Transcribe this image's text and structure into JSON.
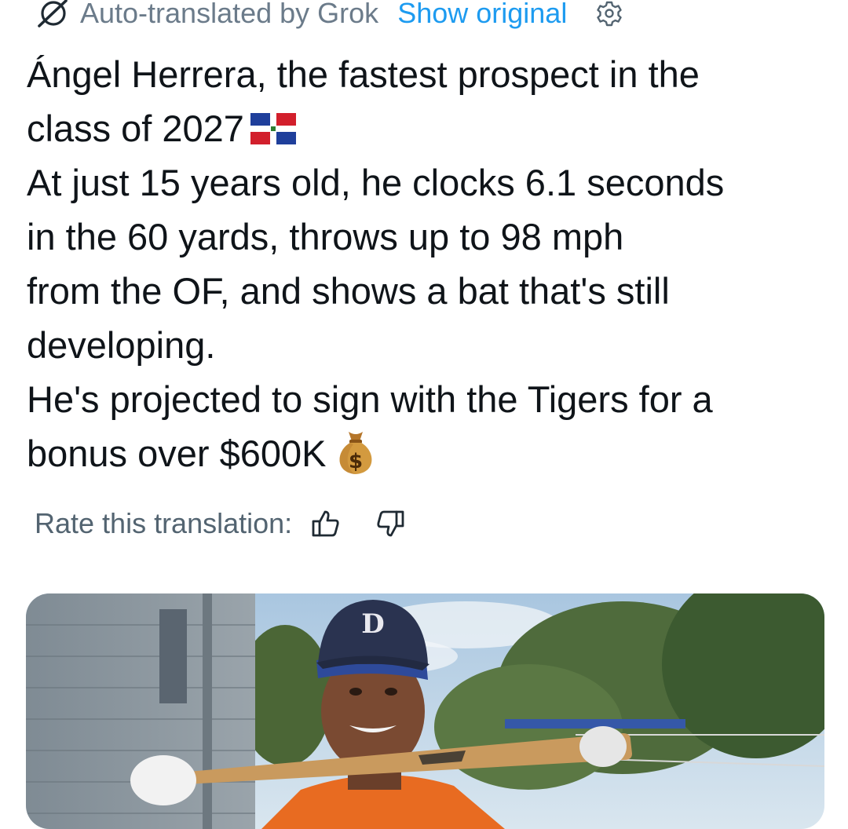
{
  "translation_bar": {
    "icon": "grok-icon",
    "label": "Auto-translated by Grok",
    "show_original": "Show original",
    "settings_icon": "gear-icon"
  },
  "tweet": {
    "lines": [
      "Ángel Herrera, the fastest prospect in the",
      "class of 2027",
      "At just 15 years old, he clocks 6.1 seconds",
      "in the 60 yards, throws up to 98 mph",
      "from the OF, and shows a bat that's still",
      "developing.",
      "He's projected to sign with the Tigers for a",
      "bonus over $600K"
    ],
    "flag_emoji": "dominican-republic-flag",
    "money_emoji": "money-bag"
  },
  "rating": {
    "label": "Rate this translation:",
    "thumbs_up_icon": "thumbs-up-icon",
    "thumbs_down_icon": "thumbs-down-icon"
  },
  "media": {
    "type": "photo",
    "cap_logo": "D"
  },
  "colors": {
    "text": "#0f1419",
    "muted": "#536471",
    "link": "#1d9bf0"
  }
}
